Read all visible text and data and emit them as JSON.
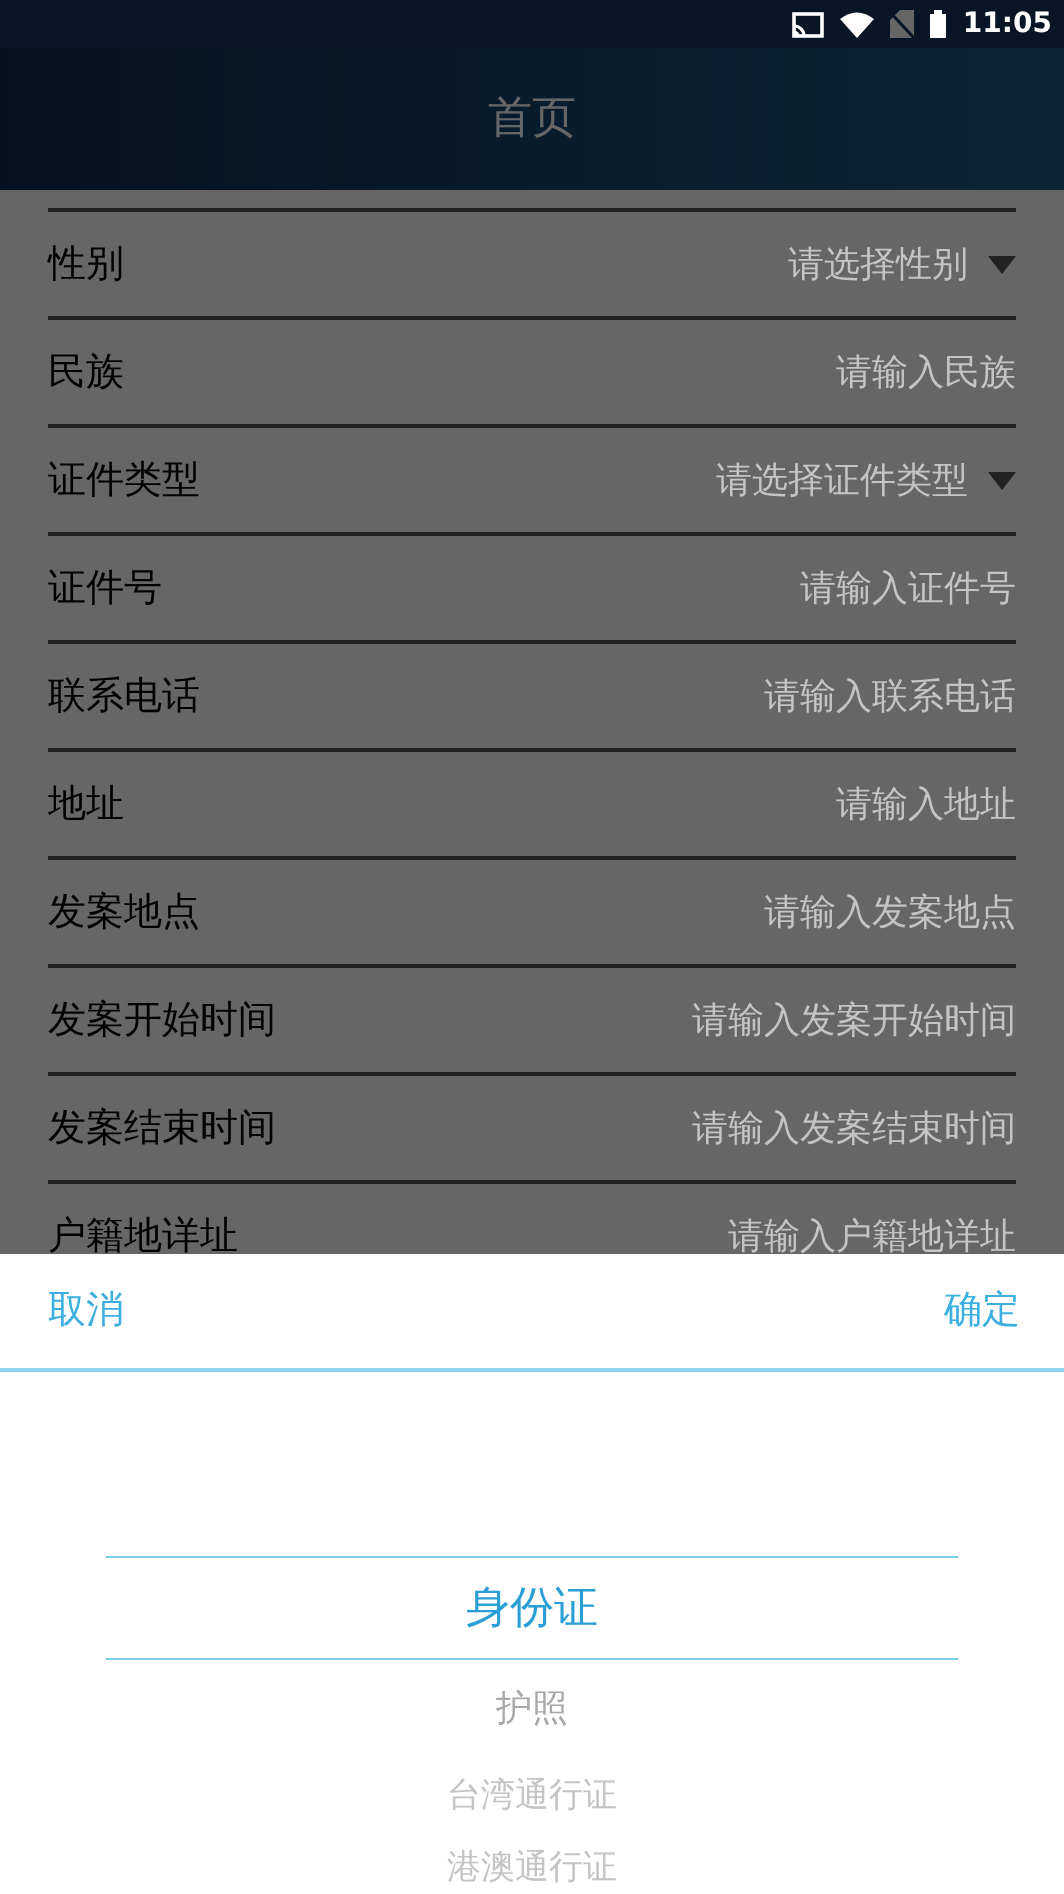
{
  "status_bar": {
    "time": "11:05"
  },
  "header": {
    "title": "首页"
  },
  "form": [
    {
      "label": "性别",
      "placeholder": "请选择性别",
      "kind": "select"
    },
    {
      "label": "民族",
      "placeholder": "请输入民族",
      "kind": "input"
    },
    {
      "label": "证件类型",
      "placeholder": "请选择证件类型",
      "kind": "select"
    },
    {
      "label": "证件号",
      "placeholder": "请输入证件号",
      "kind": "input"
    },
    {
      "label": "联系电话",
      "placeholder": "请输入联系电话",
      "kind": "input"
    },
    {
      "label": "地址",
      "placeholder": "请输入地址",
      "kind": "input"
    },
    {
      "label": "发案地点",
      "placeholder": "请输入发案地点",
      "kind": "input"
    },
    {
      "label": "发案开始时间",
      "placeholder": "请输入发案开始时间",
      "kind": "input"
    },
    {
      "label": "发案结束时间",
      "placeholder": "请输入发案结束时间",
      "kind": "input"
    },
    {
      "label": "户籍地详址",
      "placeholder": "请输入户籍地详址",
      "kind": "input"
    }
  ],
  "picker": {
    "cancel": "取消",
    "confirm": "确定",
    "options": [
      {
        "label": "身份证",
        "selected": true
      },
      {
        "label": "护照",
        "selected": false
      },
      {
        "label": "台湾通行证",
        "selected": false
      },
      {
        "label": "港澳通行证",
        "selected": false
      }
    ]
  }
}
